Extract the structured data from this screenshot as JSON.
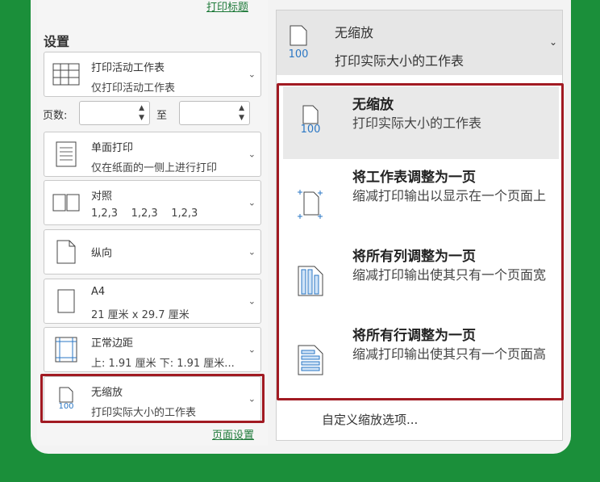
{
  "left": {
    "top_link": "打印标题",
    "section_title": "设置",
    "active_sheet": {
      "line1": "打印活动工作表",
      "line2": "仅打印活动工作表"
    },
    "pages": {
      "label": "页数:",
      "to": "至"
    },
    "one_sided": {
      "line1": "单面打印",
      "line2": "仅在纸面的一侧上进行打印"
    },
    "collated": {
      "line1": "对照",
      "line2": "1,2,3    1,2,3    1,2,3"
    },
    "orientation": {
      "label": "纵向"
    },
    "paper": {
      "line1": "A4",
      "line2": "21 厘米 x 29.7 厘米"
    },
    "margins": {
      "line1": "正常边距",
      "line2": "上: 1.91 厘米 下: 1.91 厘米..."
    },
    "scaling": {
      "line1": "无缩放",
      "line2": "打印实际大小的工作表",
      "icon_text": "100"
    },
    "page_setup_link": "页面设置"
  },
  "dropdown": {
    "header": {
      "line1": "无缩放",
      "line2": "打印实际大小的工作表",
      "icon_text": "100"
    },
    "items": [
      {
        "title": "无缩放",
        "desc": "打印实际大小的工作表",
        "icon": "no-scaling-icon",
        "icon_text": "100"
      },
      {
        "title": "将工作表调整为一页",
        "desc": "缩减打印输出以显示在一个页面上",
        "icon": "fit-sheet-icon"
      },
      {
        "title": "将所有列调整为一页",
        "desc": "缩减打印输出使其只有一个页面宽",
        "icon": "fit-columns-icon"
      },
      {
        "title": "将所有行调整为一页",
        "desc": "缩减打印输出使其只有一个页面高",
        "icon": "fit-rows-icon"
      }
    ],
    "custom": "自定义缩放选项..."
  },
  "colors": {
    "accent": "#1b8f3a",
    "highlight": "#a11a22",
    "link": "#1f7a3a",
    "blue_icon": "#2b77c4"
  }
}
